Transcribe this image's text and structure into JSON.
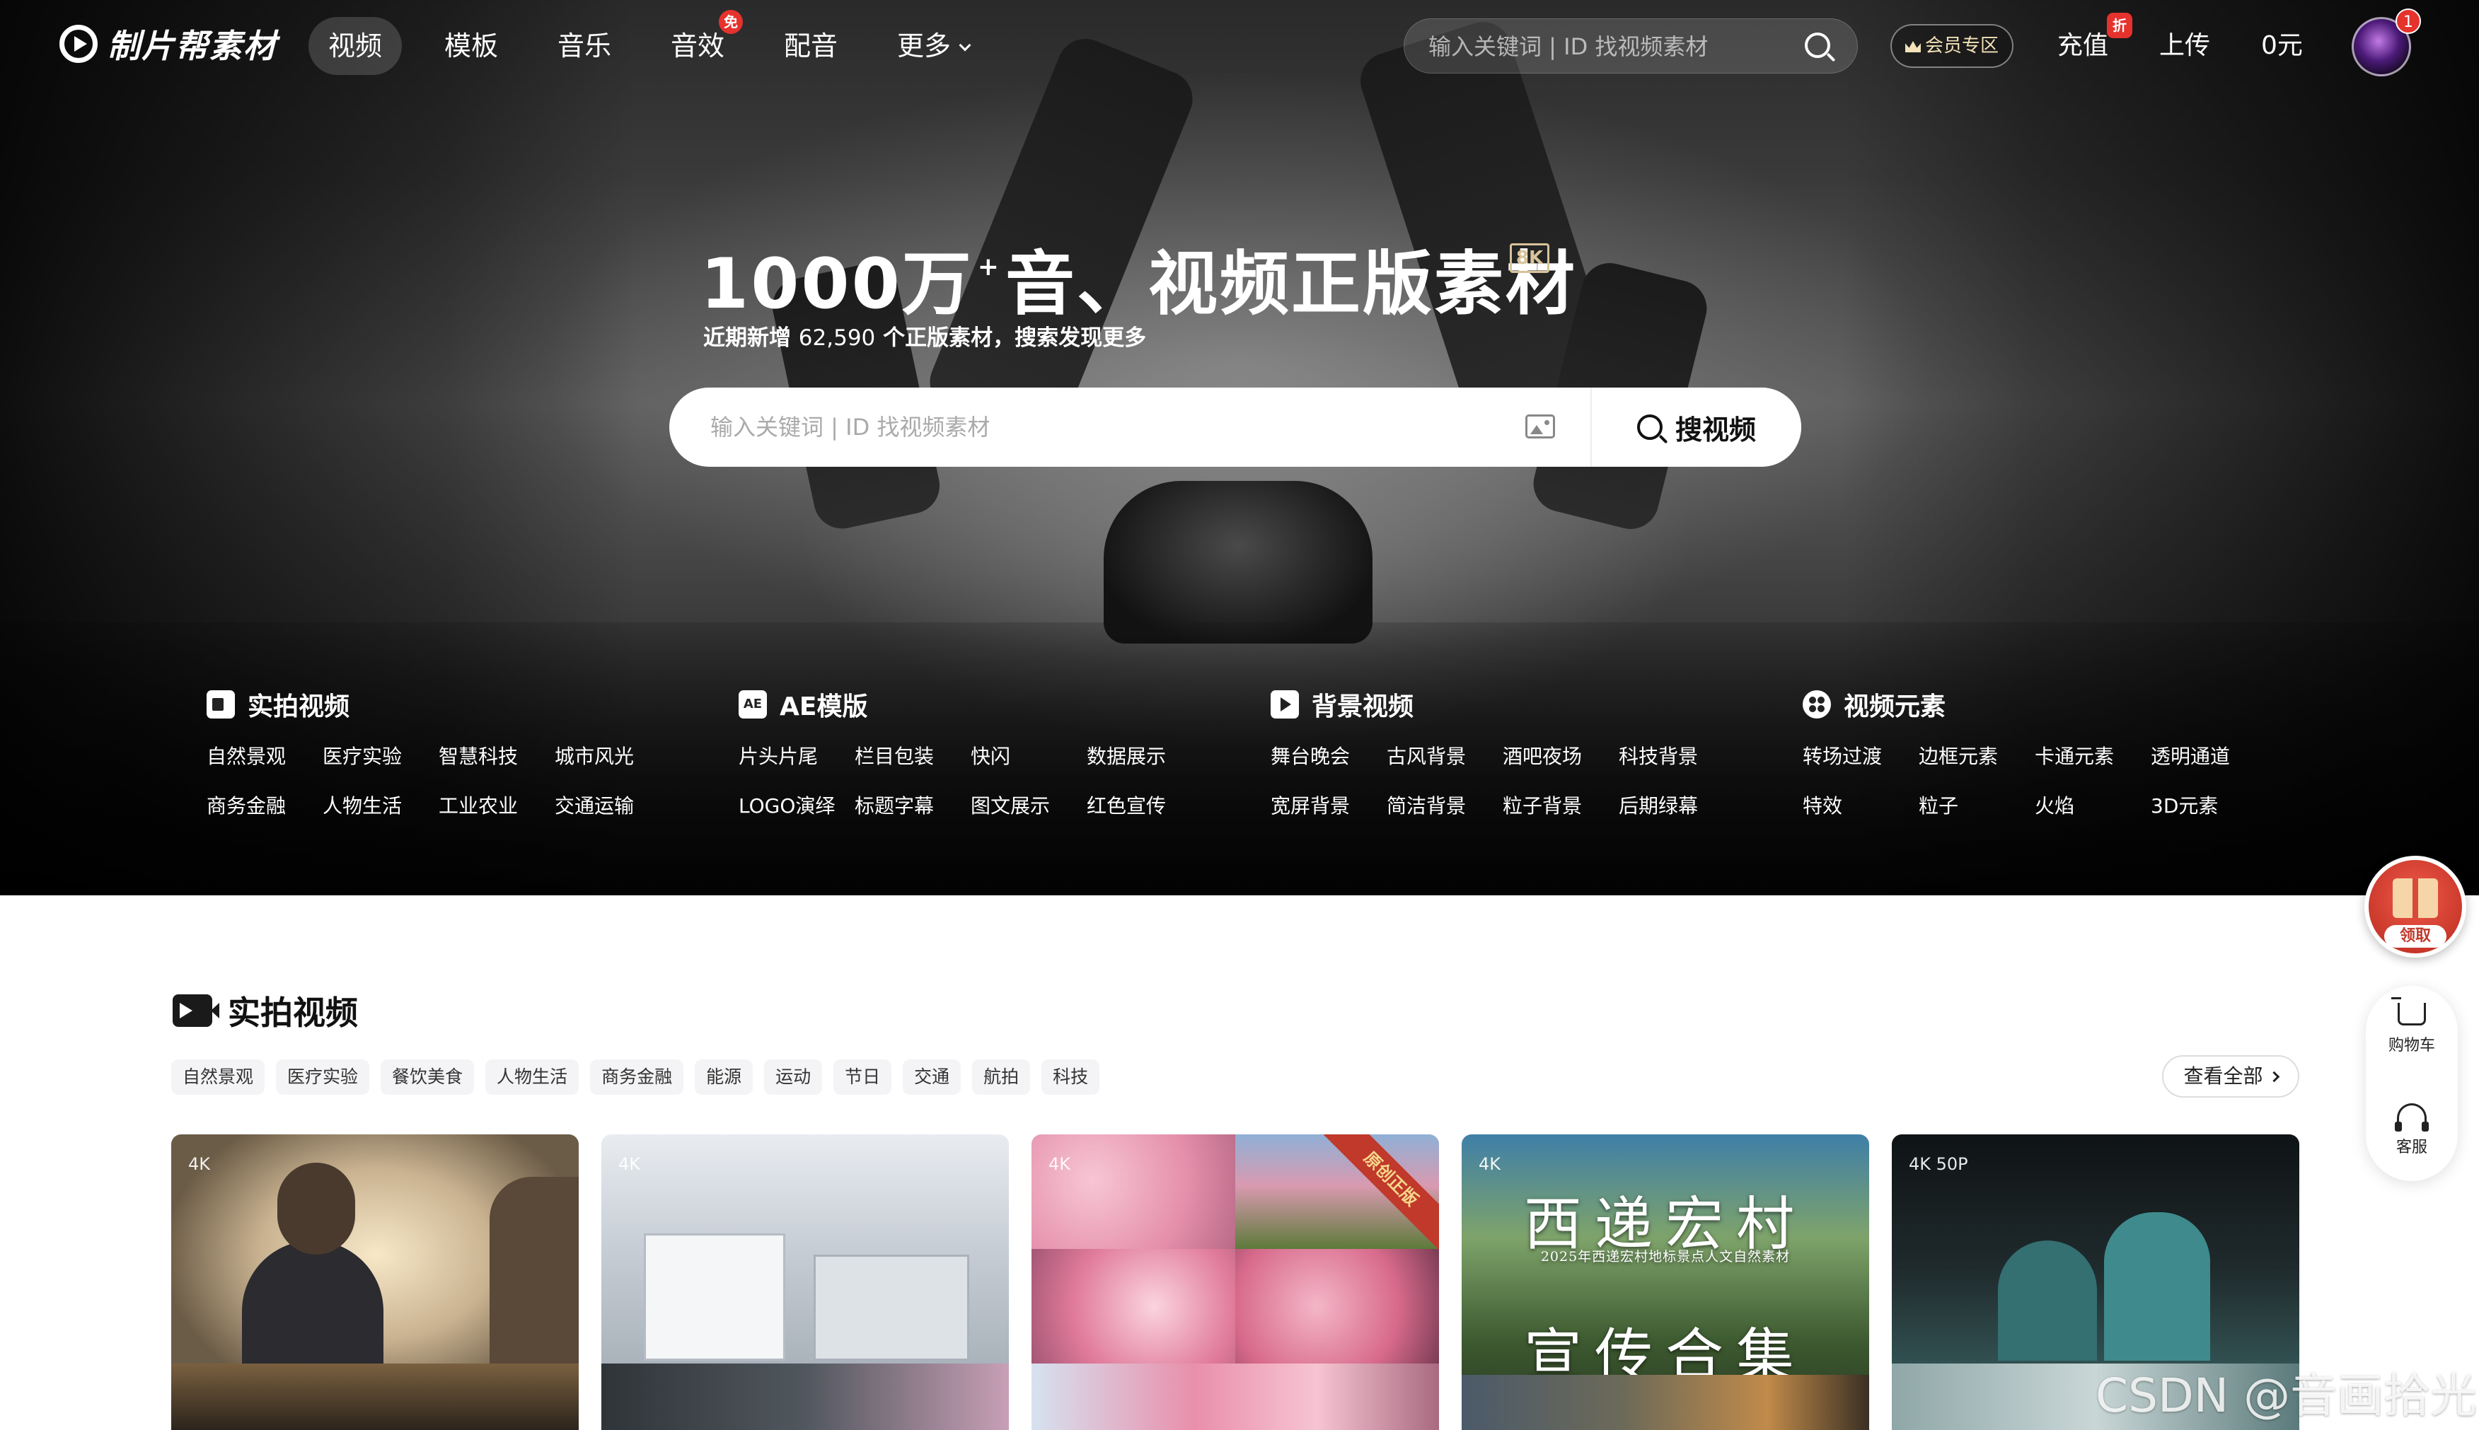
{
  "nav": {
    "logo_text": "制片帮素材",
    "tabs": [
      {
        "label": "视频",
        "active": true
      },
      {
        "label": "模板"
      },
      {
        "label": "音乐"
      },
      {
        "label": "音效",
        "badge": "免"
      },
      {
        "label": "配音"
      },
      {
        "label": "更多",
        "dropdown": true
      }
    ],
    "search_placeholder": "输入关键词 | ID 找视频素材",
    "vip_label": "会员专区",
    "recharge_label": "充值",
    "recharge_badge": "折",
    "upload_label": "上传",
    "balance": "0元",
    "avatar_badge": "1"
  },
  "hero": {
    "title_main": "1000万",
    "title_plus": "+",
    "title_rest": "音、视频正版素材",
    "badge_8k": "8K",
    "subtitle_prefix": "近期新增",
    "subtitle_count": "62,590",
    "subtitle_suffix": "个正版素材，搜索发现更多",
    "search_placeholder": "输入关键词 | ID 找视频素材",
    "search_button": "搜视频"
  },
  "categories": [
    {
      "title": "实拍视频",
      "icon": "camera-icon",
      "items": [
        "自然景观",
        "医疗实验",
        "智慧科技",
        "城市风光",
        "商务金融",
        "人物生活",
        "工业农业",
        "交通运输"
      ]
    },
    {
      "title": "AE模版",
      "icon": "ae-icon",
      "icon_text": "AE",
      "items": [
        "片头片尾",
        "栏目包装",
        "快闪",
        "数据展示",
        "LOGO演绎",
        "标题字幕",
        "图文展示",
        "红色宣传"
      ]
    },
    {
      "title": "背景视频",
      "icon": "play-icon",
      "items": [
        "舞台晚会",
        "古风背景",
        "酒吧夜场",
        "科技背景",
        "宽屏背景",
        "简洁背景",
        "粒子背景",
        "后期绿幕"
      ]
    },
    {
      "title": "视频元素",
      "icon": "elements-icon",
      "items": [
        "转场过渡",
        "边框元素",
        "卡通元素",
        "透明通道",
        "特效",
        "粒子",
        "火焰",
        "3D元素"
      ]
    }
  ],
  "section": {
    "title": "实拍视频",
    "filters": [
      "自然景观",
      "医疗实验",
      "餐饮美食",
      "人物生活",
      "商务金融",
      "能源",
      "运动",
      "节日",
      "交通",
      "航拍",
      "科技"
    ],
    "view_all": "查看全部"
  },
  "cards": [
    {
      "res": "4K"
    },
    {
      "res": "4K"
    },
    {
      "res": "4K",
      "ribbon": "原创正版"
    },
    {
      "res": "4K",
      "title1": "西递宏村",
      "title2": "宣传合集",
      "caption": "2025年西递宏村地标景点人文自然素材"
    },
    {
      "res": "4K  50P"
    }
  ],
  "sidebar": {
    "gift_label": "领取",
    "cart_label": "购物车",
    "service_label": "客服"
  },
  "watermark": "CSDN @音画拾光",
  "colors": {
    "badge_red": "#e5322d",
    "vip_gold": "#f4e2b8",
    "ribbon_red": "#c0392b",
    "chip_bg": "#f4f4f6"
  }
}
